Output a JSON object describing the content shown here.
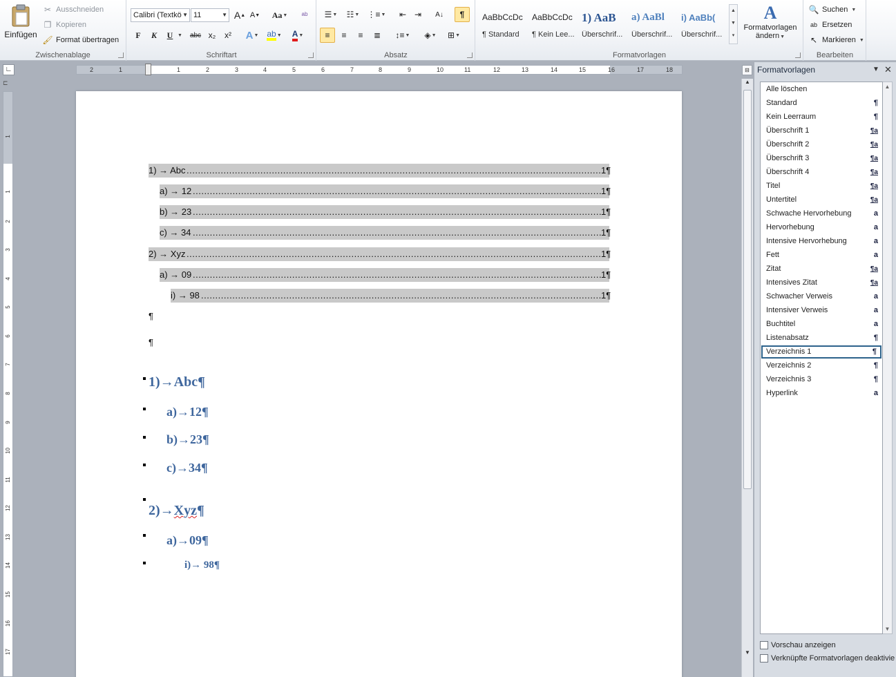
{
  "ribbon": {
    "clipboard": {
      "paste_label": "Einfügen",
      "cut_label": "Ausschneiden",
      "copy_label": "Kopieren",
      "format_painter_label": "Format übertragen",
      "group_label": "Zwischenablage"
    },
    "font": {
      "font_name": "Calibri (Textkö",
      "font_size": "11",
      "group_label": "Schriftart",
      "bold": "F",
      "italic": "K",
      "underline": "U",
      "strike": "abc",
      "subscript": "x₂",
      "superscript": "x²",
      "grow": "A",
      "shrink": "A",
      "case": "Aa",
      "color_letter": "A"
    },
    "paragraph": {
      "group_label": "Absatz",
      "show_marks": "¶"
    },
    "styles": {
      "group_label": "Formatvorlagen",
      "change_label_1": "Formatvorlagen",
      "change_label_2": "ändern",
      "gallery": [
        {
          "preview": "AaBbCcDc",
          "name": "¶ Standard"
        },
        {
          "preview": "AaBbCcDc",
          "name": "¶ Kein Lee..."
        },
        {
          "preview": "1) AaB",
          "name": "Überschrif..."
        },
        {
          "preview": "a) AaBl",
          "name": "Überschrif..."
        },
        {
          "preview": "i) AaBb(",
          "name": "Überschrif..."
        }
      ]
    },
    "editing": {
      "find_label": "Suchen",
      "replace_label": "Ersetzen",
      "select_label": "Markieren",
      "group_label": "Bearbeiten"
    }
  },
  "ruler": {
    "h_numbers": [
      "2",
      "1",
      "1",
      "2",
      "3",
      "4",
      "5",
      "6",
      "7",
      "8",
      "9",
      "10",
      "11",
      "12",
      "13",
      "14",
      "15",
      "16",
      "17",
      "18"
    ],
    "v_numbers": [
      "1",
      "1",
      "2",
      "3",
      "4",
      "5",
      "6",
      "7",
      "8",
      "9",
      "10",
      "11",
      "12",
      "13",
      "14",
      "15",
      "16",
      "17"
    ]
  },
  "document": {
    "toc": [
      {
        "label": "1) → Abc",
        "page": "1¶"
      },
      {
        "label": "a) → 12",
        "page": "1¶"
      },
      {
        "label": "b) → 23",
        "page": "1¶"
      },
      {
        "label": "c) → 34",
        "page": "1¶"
      },
      {
        "label": "2) → Xyz",
        "page": "1¶"
      },
      {
        "label": "a) → 09",
        "page": "1¶"
      },
      {
        "label": "i) → 98",
        "page": "1¶"
      }
    ],
    "empty_paragraph": "¶",
    "headings": [
      {
        "number": "1)→",
        "text": "Abc¶",
        "level": 1
      },
      {
        "number": "a)→",
        "text": "12¶",
        "level": 2
      },
      {
        "number": "b)→",
        "text": "23¶",
        "level": 2
      },
      {
        "number": "c)→",
        "text": "34¶",
        "level": 2
      },
      {
        "number": "2)→",
        "text": "Xyz",
        "mark": "¶",
        "level": 1
      },
      {
        "number": "a)→",
        "text": "09¶",
        "level": 2
      },
      {
        "number": "i)→",
        "text": " 98¶",
        "level": 3
      }
    ]
  },
  "styles_pane": {
    "title": "Formatvorlagen",
    "items": [
      {
        "name": "Alle löschen",
        "marker": "",
        "type": "none"
      },
      {
        "name": "Standard",
        "marker": "¶",
        "type": "paragraph"
      },
      {
        "name": "Kein Leerraum",
        "marker": "¶",
        "type": "paragraph"
      },
      {
        "name": "Überschrift 1",
        "marker": "¶a",
        "type": "linked"
      },
      {
        "name": "Überschrift 2",
        "marker": "¶a",
        "type": "linked"
      },
      {
        "name": "Überschrift 3",
        "marker": "¶a",
        "type": "linked"
      },
      {
        "name": "Überschrift 4",
        "marker": "¶a",
        "type": "linked"
      },
      {
        "name": "Titel",
        "marker": "¶a",
        "type": "linked"
      },
      {
        "name": "Untertitel",
        "marker": "¶a",
        "type": "linked"
      },
      {
        "name": "Schwache Hervorhebung",
        "marker": "a",
        "type": "character"
      },
      {
        "name": "Hervorhebung",
        "marker": "a",
        "type": "character"
      },
      {
        "name": "Intensive Hervorhebung",
        "marker": "a",
        "type": "character"
      },
      {
        "name": "Fett",
        "marker": "a",
        "type": "character"
      },
      {
        "name": "Zitat",
        "marker": "¶a",
        "type": "linked"
      },
      {
        "name": "Intensives Zitat",
        "marker": "¶a",
        "type": "linked"
      },
      {
        "name": "Schwacher Verweis",
        "marker": "a",
        "type": "character"
      },
      {
        "name": "Intensiver Verweis",
        "marker": "a",
        "type": "character"
      },
      {
        "name": "Buchtitel",
        "marker": "a",
        "type": "character"
      },
      {
        "name": "Listenabsatz",
        "marker": "¶",
        "type": "paragraph"
      },
      {
        "name": "Verzeichnis 1",
        "marker": "¶",
        "type": "paragraph",
        "selected": true
      },
      {
        "name": "Verzeichnis 2",
        "marker": "¶",
        "type": "paragraph"
      },
      {
        "name": "Verzeichnis 3",
        "marker": "¶",
        "type": "paragraph"
      },
      {
        "name": "Hyperlink",
        "marker": "a",
        "type": "character"
      }
    ],
    "preview_label": "Vorschau anzeigen",
    "linked_label": "Verknüpfte Formatvorlagen deaktivie"
  },
  "colors": {
    "heading": "#3e669d",
    "toc_highlight": "#c9c9c9",
    "selection_border": "#2c628b"
  }
}
